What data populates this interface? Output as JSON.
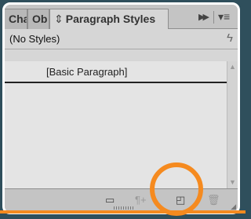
{
  "tabs": [
    {
      "label": "Cha",
      "active": false
    },
    {
      "label": "Ob",
      "active": false
    },
    {
      "label": "Paragraph Styles",
      "active": true,
      "icon": "up-down-arrows-icon"
    }
  ],
  "header_icons": {
    "collapse": "double-right-arrow-icon",
    "menu": "panel-menu-icon"
  },
  "current_style_label": "(No Styles)",
  "styles_list": [
    {
      "label": "[Basic Paragraph]"
    }
  ],
  "footer_buttons": [
    {
      "name": "new-style-group-button",
      "icon": "folder-icon",
      "enabled": true
    },
    {
      "name": "clear-overrides-button",
      "icon": "pilcrow-plus-icon",
      "enabled": false
    },
    {
      "name": "new-style-button",
      "icon": "new-page-icon",
      "enabled": true
    },
    {
      "name": "delete-style-button",
      "icon": "trash-icon",
      "enabled": false
    }
  ],
  "colors": {
    "background": "#2f4f5c",
    "highlight": "#f58a1f",
    "panel": "#d6d6d6"
  }
}
